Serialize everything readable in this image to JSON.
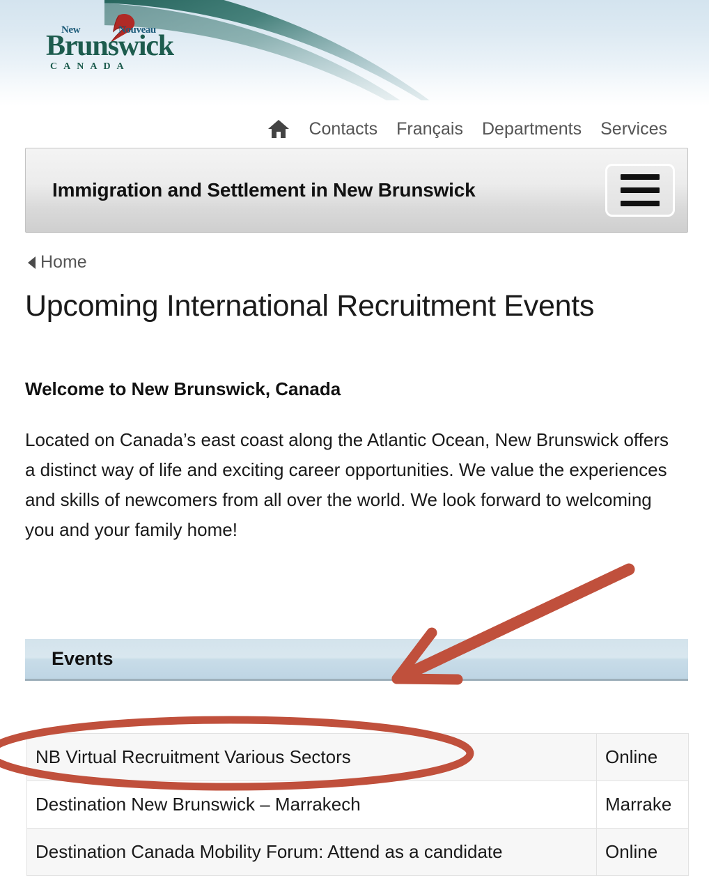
{
  "masthead": {
    "logo": {
      "new": "New",
      "nouveau": "Nouveau",
      "brunswick": "Brunswick",
      "canada": "CANADA",
      "bird_icon": "cardinal-bird-icon"
    }
  },
  "topnav": {
    "home_icon": "home-icon",
    "items": [
      {
        "label": "Contacts"
      },
      {
        "label": "Français"
      },
      {
        "label": "Departments"
      },
      {
        "label": "Services"
      }
    ]
  },
  "titlebar": {
    "site_title": "Immigration and Settlement in New Brunswick",
    "menu_icon": "hamburger-menu-icon"
  },
  "breadcrumb": {
    "back_icon": "left-triangle-icon",
    "home_label": "Home"
  },
  "page": {
    "title": "Upcoming International Recruitment Events",
    "welcome_heading": "Welcome to New Brunswick, Canada",
    "intro_paragraph": "Located on Canada’s east coast along the Atlantic Ocean, New Brunswick offers a distinct way of life and exciting career opportunities. We value the experiences and skills of newcomers from all over the world. We look forward to welcoming you and your family home!"
  },
  "events": {
    "banner_label": "Events",
    "rows": [
      {
        "name": "NB Virtual Recruitment Various Sectors",
        "location": "Online"
      },
      {
        "name": "Destination New Brunswick – Marrakech",
        "location": "Marrake"
      },
      {
        "name": "Destination Canada Mobility Forum: Attend as a candidate",
        "location": "Online"
      }
    ]
  },
  "annotations": {
    "arrow_icon": "red-arrow-annotation",
    "ellipse_icon": "red-ellipse-annotation",
    "color": "#c0503c"
  },
  "colors": {
    "header_blue": "#d4e4ef",
    "swoosh_green": "#1d5c4e",
    "banner_blue": "#cfe0ea",
    "annotation_red": "#c0503c"
  }
}
